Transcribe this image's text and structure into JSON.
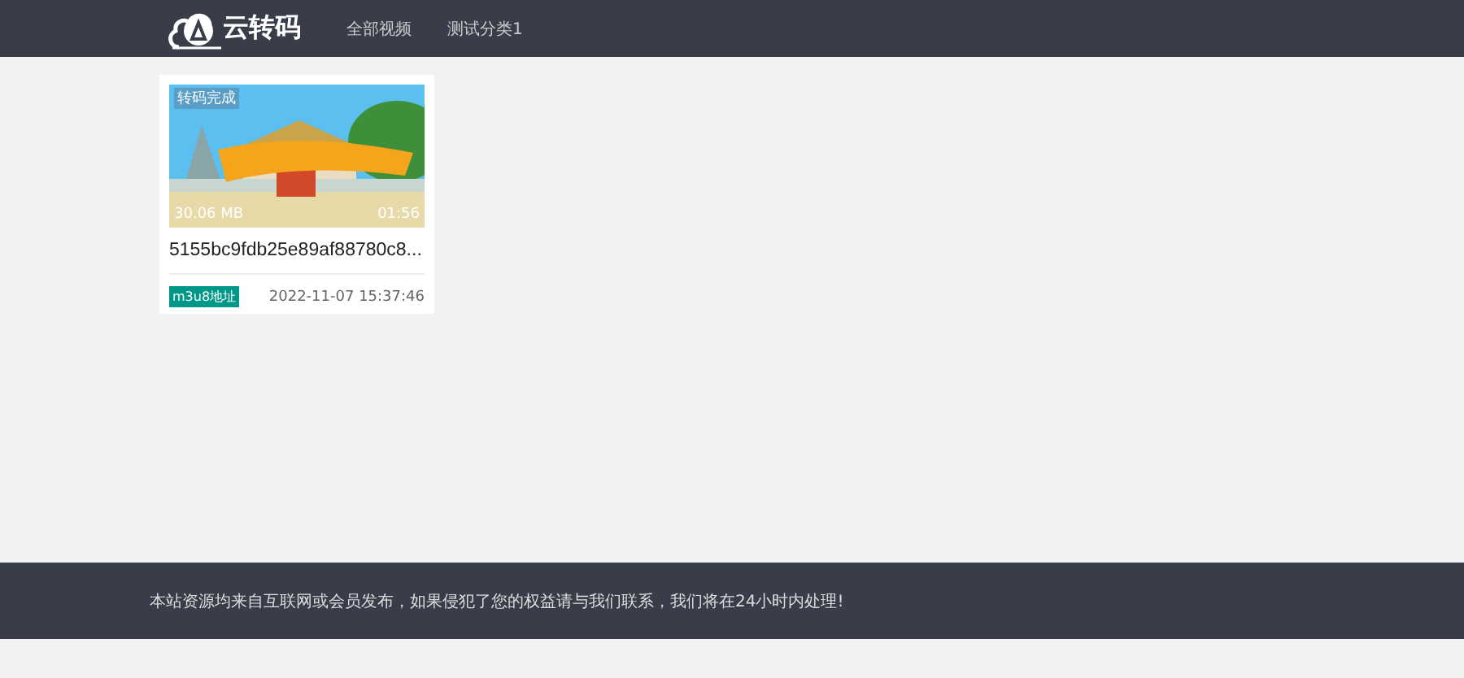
{
  "header": {
    "logo": "云转码",
    "nav": [
      {
        "label": "全部视频",
        "selected": false
      },
      {
        "label": "测试分类1",
        "selected": false
      }
    ]
  },
  "videos": [
    {
      "status": "转码完成",
      "size": "30.06 MB",
      "duration": "01:56",
      "title": "5155bc9fdb25e89af88780c8...",
      "tag": "m3u8地址",
      "date": "2022-11-07 15:37:46"
    }
  ],
  "footer": {
    "notice": "本站资源均来自互联网或会员发布，如果侵犯了您的权益请与我们联系，我们将在24小时内处理!"
  }
}
